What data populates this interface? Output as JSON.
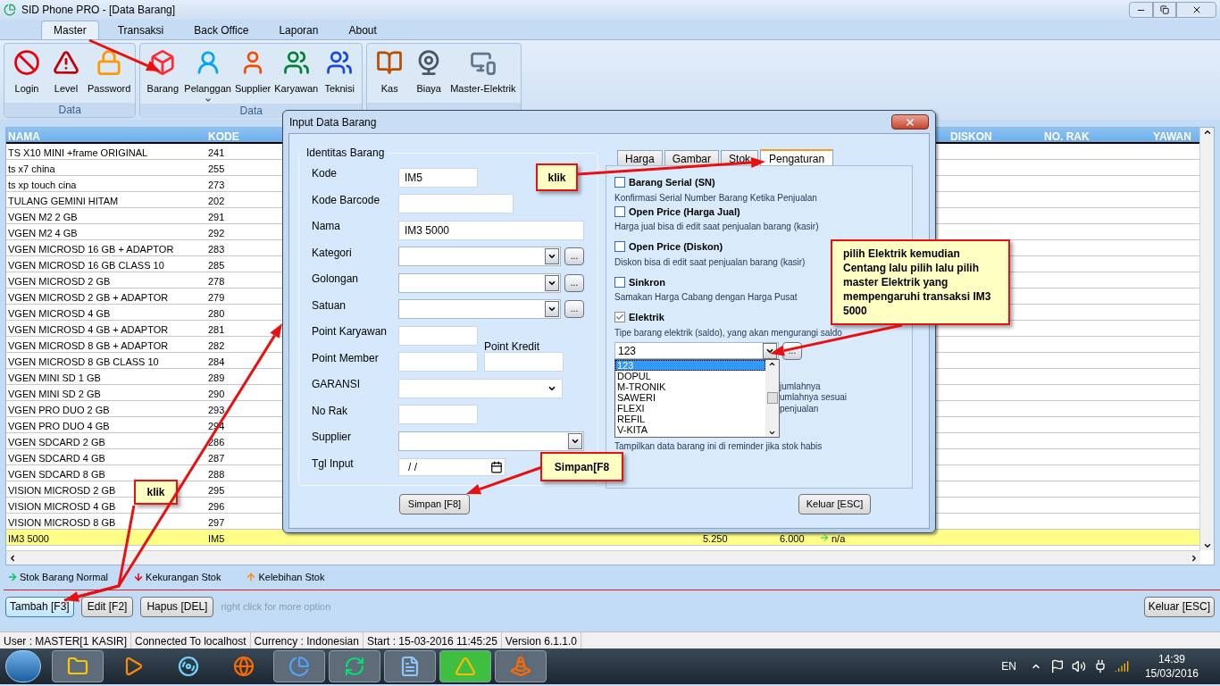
{
  "window": {
    "title": "SID Phone PRO - [Data Barang]"
  },
  "ribbon_tabs": [
    {
      "label": "Master",
      "selected": true
    },
    {
      "label": "Transaksi",
      "selected": false
    },
    {
      "label": "Back Office",
      "selected": false
    },
    {
      "label": "Laporan",
      "selected": false
    },
    {
      "label": "About",
      "selected": false
    }
  ],
  "ribbon_groups": [
    {
      "label": "Data",
      "items": [
        {
          "label": "Login"
        },
        {
          "label": "Level"
        },
        {
          "label": "Password"
        }
      ]
    },
    {
      "label": "Data",
      "items": [
        {
          "label": "Barang"
        },
        {
          "label": "Pelanggan",
          "dropdown": true
        },
        {
          "label": "Supplier"
        },
        {
          "label": "Karyawan"
        },
        {
          "label": "Teknisi"
        }
      ]
    },
    {
      "items": [
        {
          "label": "Kas"
        },
        {
          "label": "Biaya"
        },
        {
          "label": "Master-Elektrik"
        }
      ]
    }
  ],
  "table": {
    "columns": [
      {
        "label": "NAMA"
      },
      {
        "label": "KODE"
      },
      {
        "label": "DISKON"
      },
      {
        "label": "NO. RAK"
      },
      {
        "label": "YAWAN"
      }
    ],
    "rows": [
      {
        "nama": "TS X10 MINI +frame ORIGINAL",
        "kode": "241",
        "selected": false
      },
      {
        "nama": "ts x7 china",
        "kode": "255",
        "selected": false
      },
      {
        "nama": "ts xp touch cina",
        "kode": "273",
        "selected": false
      },
      {
        "nama": "TULANG GEMINI HITAM",
        "kode": "202",
        "selected": false
      },
      {
        "nama": "VGEN M2 2 GB",
        "kode": "291",
        "selected": false
      },
      {
        "nama": "VGEN M2 4 GB",
        "kode": "292",
        "selected": false
      },
      {
        "nama": "VGEN MICROSD 16 GB + ADAPTOR",
        "kode": "283",
        "selected": false
      },
      {
        "nama": "VGEN MICROSD 16 GB CLASS 10",
        "kode": "285",
        "selected": false
      },
      {
        "nama": "VGEN MICROSD 2 GB",
        "kode": "278",
        "selected": false
      },
      {
        "nama": "VGEN MICROSD 2 GB + ADAPTOR",
        "kode": "279",
        "selected": false
      },
      {
        "nama": "VGEN MICROSD 4 GB",
        "kode": "280",
        "selected": false
      },
      {
        "nama": "VGEN MICROSD 4 GB + ADAPTOR",
        "kode": "281",
        "selected": false
      },
      {
        "nama": "VGEN MICROSD 8 GB + ADAPTOR",
        "kode": "282",
        "selected": false
      },
      {
        "nama": "VGEN MICROSD 8 GB CLASS 10",
        "kode": "284",
        "selected": false
      },
      {
        "nama": "VGEN MINI SD 1 GB",
        "kode": "289",
        "selected": false
      },
      {
        "nama": "VGEN MINI SD 2 GB",
        "kode": "290",
        "selected": false
      },
      {
        "nama": "VGEN PRO DUO 2 GB",
        "kode": "293",
        "selected": false
      },
      {
        "nama": "VGEN PRO DUO 4 GB",
        "kode": "294",
        "selected": false
      },
      {
        "nama": "VGEN SDCARD 2 GB",
        "kode": "286",
        "selected": false
      },
      {
        "nama": "VGEN SDCARD 4 GB",
        "kode": "287",
        "selected": false
      },
      {
        "nama": "VGEN SDCARD 8 GB",
        "kode": "288",
        "selected": false
      },
      {
        "nama": "VISION MICROSD 2 GB",
        "kode": "295",
        "selected": false
      },
      {
        "nama": "VISION MICROSD 4 GB",
        "kode": "296",
        "selected": false
      },
      {
        "nama": "VISION MICROSD 8 GB",
        "kode": "297",
        "selected": false
      },
      {
        "nama": "IM3 5000",
        "kode": "IM5",
        "selected": true,
        "column_3": "5.250",
        "column_4": "6.000",
        "column_5": "n/a"
      }
    ]
  },
  "legend": [
    {
      "label": "Stok Barang Normal",
      "kind": "normal"
    },
    {
      "label": "Kekurangan Stok",
      "kind": "low"
    },
    {
      "label": "Kelebihan Stok",
      "kind": "high"
    }
  ],
  "actions": {
    "buttons": [
      {
        "label": "Tambah [F3]",
        "focused": true
      },
      {
        "label": "Edit [F2]",
        "focused": false
      },
      {
        "label": "Hapus [DEL]",
        "focused": false
      }
    ],
    "hint": "right click for more option",
    "close_button": "Keluar [ESC]"
  },
  "status_bar": [
    "User : MASTER[1 KASIR]",
    "Connected To localhost",
    "Currency : Indonesian",
    "Start  : 15-03-2016 11:45:25",
    "Version 6.1.1.0"
  ],
  "dialog": {
    "title": "Input Data Barang",
    "group_title": "Identitas Barang",
    "browse_label": "...",
    "fields": [
      {
        "label": "Kode",
        "kind": "short",
        "value": "IM5"
      },
      {
        "label": "Kode Barcode",
        "kind": "medium"
      },
      {
        "label": "Nama",
        "kind": "long",
        "value": "IM3 5000"
      },
      {
        "label": "Kategori",
        "kind": "combo"
      },
      {
        "label": "Golongan",
        "kind": "combo"
      },
      {
        "label": "Satuan",
        "kind": "combo"
      },
      {
        "label": "Point Karyawan",
        "kind": "short",
        "side_label": "Point Kredit"
      },
      {
        "label": "Point Member",
        "kind": "pair"
      },
      {
        "label": "GARANSI",
        "kind": "select"
      },
      {
        "label": "No Rak",
        "kind": "short"
      },
      {
        "label": "Supplier",
        "kind": "combo_long"
      },
      {
        "label": "Tgl Input",
        "kind": "date",
        "value": "/  /"
      }
    ],
    "tabs": [
      {
        "label": "Harga",
        "selected": false
      },
      {
        "label": "Gambar",
        "selected": false
      },
      {
        "label": "Stok",
        "selected": false
      },
      {
        "label": "Pengaturan",
        "selected": true
      }
    ],
    "options": [
      {
        "label": "Barang Serial (SN)",
        "description": "Konfirmasi Serial Number Barang Ketika Penjualan",
        "checked": false
      },
      {
        "label": "Open Price (Harga Jual)",
        "description": "Harga jual bisa di edit saat penjualan barang (kasir)",
        "checked": false
      },
      {
        "label": "Open Price (Diskon)",
        "description": "Diskon bisa di edit saat penjualan barang (kasir)",
        "checked": false
      },
      {
        "label": "Sinkron",
        "description": "Samakan Harga Cabang dengan Harga Pusat",
        "checked": false
      },
      {
        "label": "Elektrik",
        "description": "Tipe barang elektrik (saldo), yang akan mengurangi saldo",
        "checked": true,
        "combo": {
          "value": "123",
          "list": [
            {
              "label": "123",
              "selected": true
            },
            {
              "label": "DOPUL",
              "selected": false
            },
            {
              "label": "M-TRONIK",
              "selected": false
            },
            {
              "label": "SAWERI",
              "selected": false
            },
            {
              "label": "FLEXI",
              "selected": false
            },
            {
              "label": "REFIL",
              "selected": false
            },
            {
              "label": "V-KITA",
              "selected": false
            }
          ]
        }
      }
    ],
    "partly_hidden_texts": [
      "jumlahnya",
      "umlahnya sesuai",
      "penjualan"
    ],
    "reminder_text": "Tampilkan data barang ini di reminder jika stok habis",
    "buttons": [
      "Simpan [F8]",
      "Keluar [ESC]"
    ]
  },
  "callouts": [
    "klik",
    "pilih Elektrik kemudian Centang lalu pilih lalu pilih master Elektrik yang mempengaruhi transaksi IM3 5000",
    "Simpan[F8",
    "klik"
  ],
  "taskbar": {
    "apps": [
      {
        "running": true,
        "selected": false
      },
      {
        "running": false,
        "selected": false
      },
      {
        "running": false,
        "selected": false
      },
      {
        "running": false,
        "selected": false
      },
      {
        "running": true,
        "selected": false
      },
      {
        "running": true,
        "selected": false
      },
      {
        "running": true,
        "selected": false
      },
      {
        "running": true,
        "selected": true
      },
      {
        "running": true,
        "selected": false
      }
    ],
    "language": "EN",
    "time": "14:39",
    "date": "15/03/2016"
  }
}
